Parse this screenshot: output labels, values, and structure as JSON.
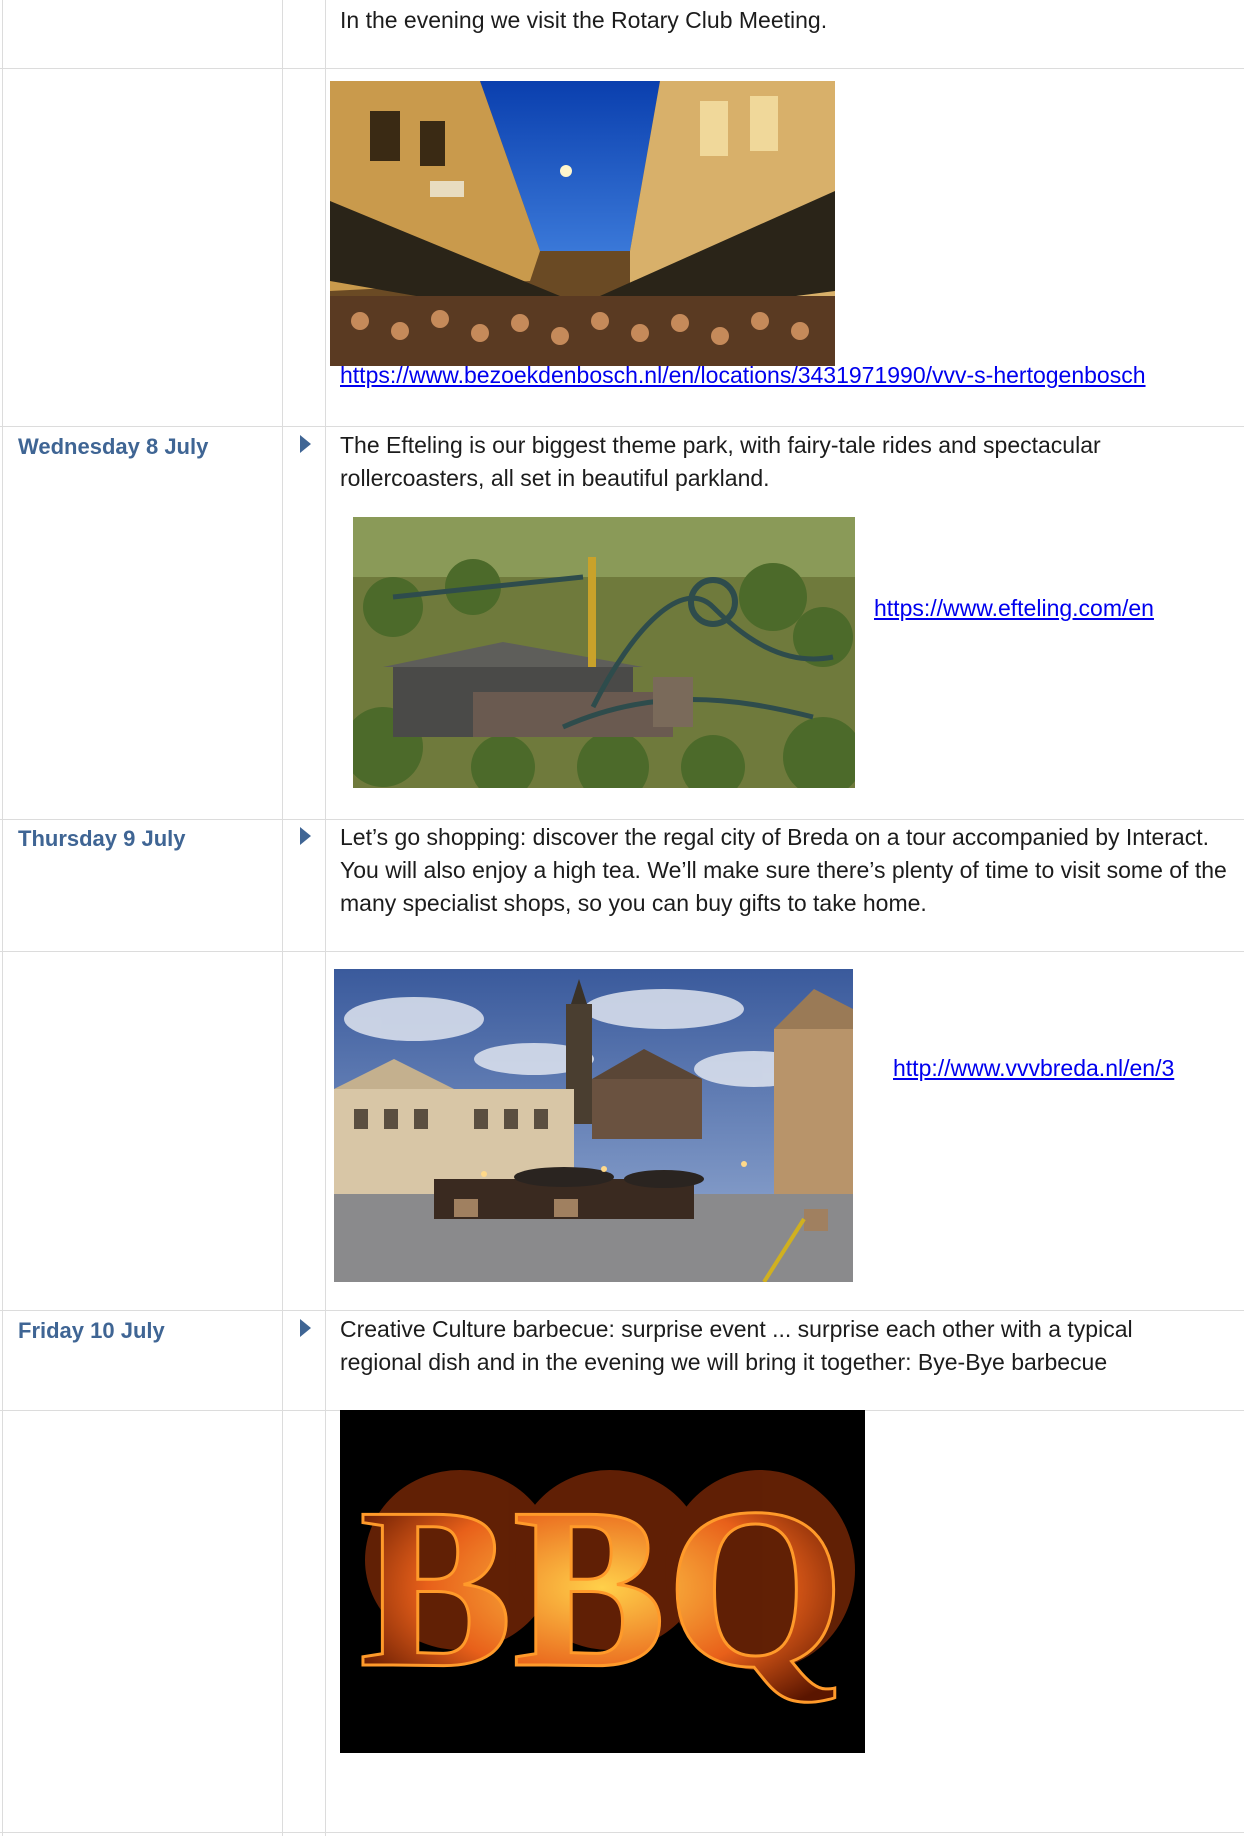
{
  "rows": {
    "tuesday_evening": {
      "text": "In the evening we visit the Rotary Club Meeting."
    },
    "denbosch": {
      "link": "https://www.bezoekdenbosch.nl/en/locations/3431971990/vvv-s-hertogenbosch"
    },
    "wednesday": {
      "day": "Wednesday 8 July",
      "text": "The Efteling is our biggest theme park, with fairy-tale rides and spectacular rollercoasters, all set in beautiful parkland.",
      "link": "https://www.efteling.com/en"
    },
    "thursday": {
      "day": "Thursday 9 July",
      "text": "Let’s go shopping: discover the regal city of Breda on a tour accompanied by Interact. You will also enjoy a high tea. We’ll make sure there’s plenty of time to visit some of the many specialist shops, so you can buy gifts to take home.",
      "link": "http://www.vvvbreda.nl/en/3"
    },
    "friday": {
      "day": "Friday 10 July",
      "text": "Creative Culture barbecue: surprise event ... surprise each other with a typical regional dish and in the evening we will bring it together: Bye-Bye barbecue",
      "bbq_text": "BBQ"
    }
  },
  "icons": {
    "bullet": "triangle-right-icon"
  },
  "colors": {
    "day_label": "#3f6594",
    "link": "#0000ee",
    "grid": "#dcdcdc"
  }
}
